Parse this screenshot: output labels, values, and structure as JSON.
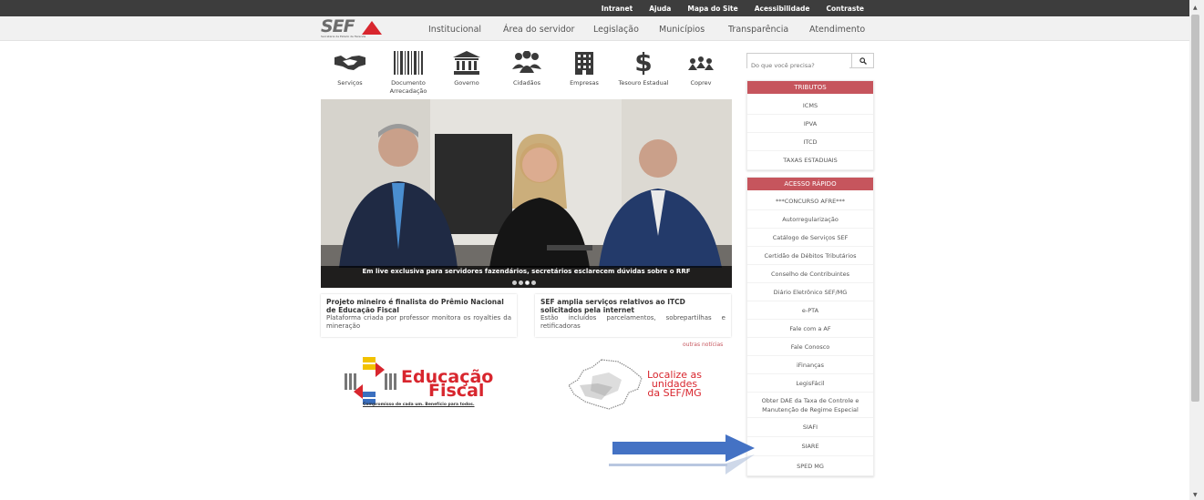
{
  "topbar": {
    "links": [
      "Intranet",
      "Ajuda",
      "Mapa do Site",
      "Acessibilidade",
      "Contraste"
    ]
  },
  "header": {
    "logo_text": "SEF",
    "logo_subtitle": "Secretaria de Estado de Fazenda",
    "nav": [
      "Institucional",
      "Área do servidor",
      "Legislação",
      "Municípios",
      "Transparência",
      "Atendimento"
    ]
  },
  "icons": [
    {
      "label": "Serviços",
      "icon": "handshake-icon"
    },
    {
      "label": "Documento Arrecadação",
      "icon": "barcode-icon"
    },
    {
      "label": "Governo",
      "icon": "government-building-icon"
    },
    {
      "label": "Cidadãos",
      "icon": "people-icon"
    },
    {
      "label": "Empresas",
      "icon": "office-building-icon"
    },
    {
      "label": "Tesouro Estadual",
      "icon": "dollar-icon"
    },
    {
      "label": "Coprev",
      "icon": "coprev-icon"
    }
  ],
  "search": {
    "placeholder": "Do que você precisa?"
  },
  "tributos": {
    "title": "TRIBUTOS",
    "items": [
      "ICMS",
      "IPVA",
      "ITCD",
      "TAXAS ESTADUAIS"
    ]
  },
  "acesso_rapido": {
    "title": "ACESSO RÁPIDO",
    "items": [
      "***CONCURSO AFRE***",
      "Autorregularização",
      "Catálogo de Serviços SEF",
      "Certidão de Débitos Tributários",
      "Conselho de Contribuintes",
      "Diário Eletrônico SEF/MG",
      "e-PTA",
      "Fale com a AF",
      "Fale Conosco",
      "iFinanças",
      "LegisFácil",
      "Obter DAE da Taxa de Controle e Manutenção de Regime Especial",
      "SIAFI",
      "SIARE",
      "SPED MG"
    ]
  },
  "banner": {
    "caption": "Em live exclusiva para servidores fazendários, secretários esclarecem dúvidas sobre o RRF"
  },
  "news": [
    {
      "title": "Projeto mineiro é finalista do Prêmio Nacional de Educação Fiscal",
      "text": "Plataforma criada por professor monitora os royalties da mineração"
    },
    {
      "title": "SEF amplia serviços relativos ao ITCD solicitados pela internet",
      "text": "Estão incluídos parcelamentos, sobrepartilhas e retificadoras"
    }
  ],
  "more_news": "outras notícias",
  "educacao": {
    "line1": "Educação",
    "line2": "Fiscal",
    "tagline": "Compromisso de cada um. Benefício para todos."
  },
  "localize": {
    "line1": "Localize as",
    "line2": "unidades",
    "line3": "da SEF/MG"
  },
  "colors": {
    "accent": "#c6555d",
    "brand_red": "#d8262e",
    "arrow": "#4472c4"
  }
}
